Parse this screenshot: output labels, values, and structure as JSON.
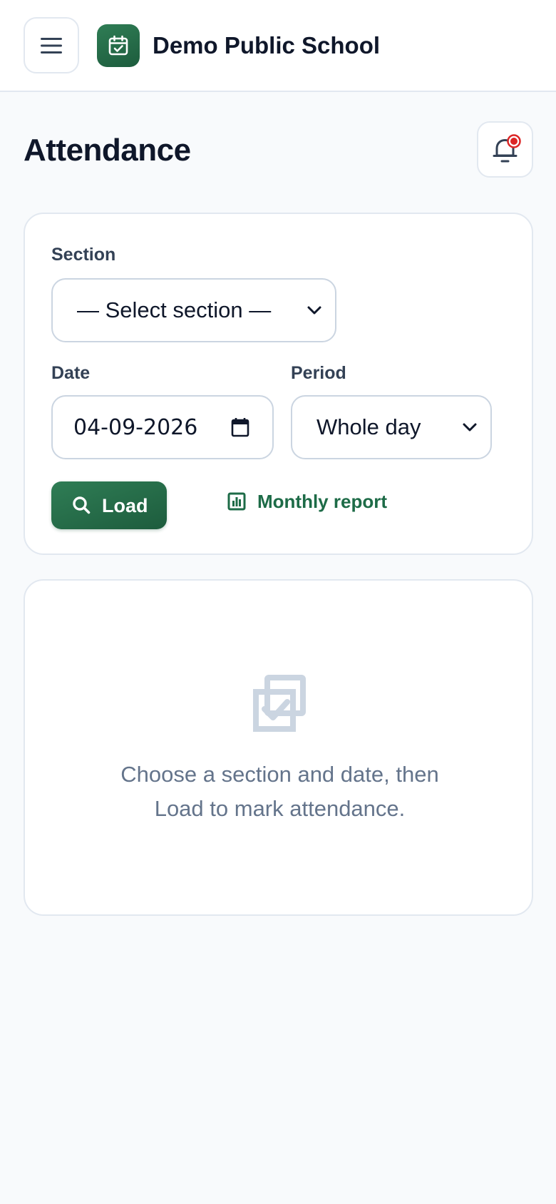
{
  "header": {
    "brand_name": "Demo Public School",
    "menu_icon": "hamburger-menu-icon",
    "logo_icon": "calendar-check-icon"
  },
  "page": {
    "title": "Attendance",
    "notification_icon": "bell-icon",
    "notification_dot_color": "#dc2626"
  },
  "filters": {
    "section_label": "Section",
    "section_value": "— Select section —",
    "date_label": "Date",
    "date_value": "04-09-2026",
    "period_label": "Period",
    "period_value": "Whole day",
    "load_label": "Load",
    "load_icon": "search-icon",
    "report_label": "Monthly report",
    "report_icon": "bar-chart-icon"
  },
  "empty_state": {
    "icon": "copy-check-icon",
    "message_line1": "Choose a section and date, then",
    "message_line2": "Load to mark attendance."
  },
  "colors": {
    "accent": "#1d5c3d",
    "accent_text": "#1d6b47",
    "background": "#f8fafc",
    "border": "#e2e8f0",
    "muted_text": "#64748b"
  }
}
